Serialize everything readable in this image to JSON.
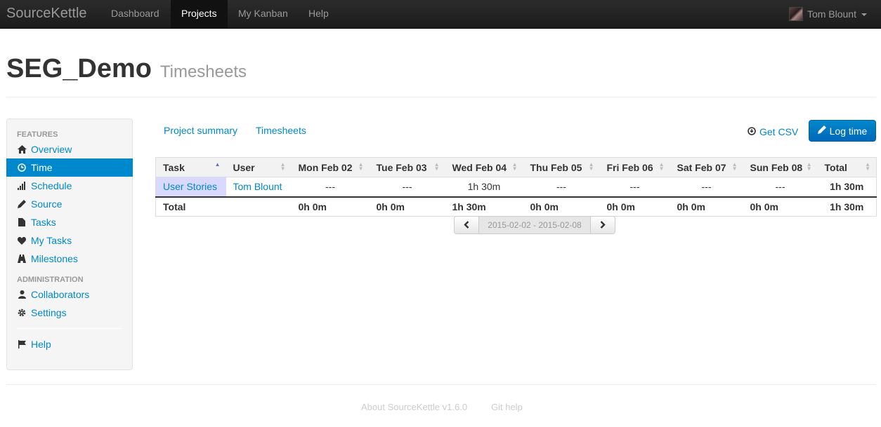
{
  "navbar": {
    "brand": "SourceKettle",
    "items": [
      {
        "label": "Dashboard"
      },
      {
        "label": "Projects"
      },
      {
        "label": "My Kanban"
      },
      {
        "label": "Help"
      }
    ],
    "active_item": "Projects",
    "user_name": "Tom Blount"
  },
  "page": {
    "title": "SEG_Demo",
    "subtitle": "Timesheets"
  },
  "sidebar": {
    "features_header": "FEATURES",
    "features": [
      {
        "label": "Overview",
        "icon": "home-icon"
      },
      {
        "label": "Time",
        "icon": "clock-icon",
        "active": true
      },
      {
        "label": "Schedule",
        "icon": "signal-icon"
      },
      {
        "label": "Source",
        "icon": "pencil-icon"
      },
      {
        "label": "Tasks",
        "icon": "file-icon"
      },
      {
        "label": "My Tasks",
        "icon": "heart-icon"
      },
      {
        "label": "Milestones",
        "icon": "road-icon"
      }
    ],
    "admin_header": "ADMINISTRATION",
    "admin": [
      {
        "label": "Collaborators",
        "icon": "user-icon"
      },
      {
        "label": "Settings",
        "icon": "cog-icon"
      }
    ],
    "help": {
      "label": "Help",
      "icon": "flag-icon"
    }
  },
  "tabs": [
    {
      "label": "Project summary"
    },
    {
      "label": "Timesheets"
    }
  ],
  "actions": {
    "csv_label": "Get CSV",
    "log_time_label": "Log time"
  },
  "timesheet": {
    "headers": [
      "Task",
      "User",
      "Mon Feb 02",
      "Tue Feb 03",
      "Wed Feb 04",
      "Thu Feb 05",
      "Fri Feb 06",
      "Sat Feb 07",
      "Sun Feb 08",
      "Total"
    ],
    "row": {
      "task": "User Stories",
      "user": "Tom Blount",
      "days": [
        "---",
        "---",
        "1h 30m",
        "---",
        "---",
        "---",
        "---"
      ],
      "total": "1h 30m"
    },
    "total_row": {
      "label": "Total",
      "days": [
        "0h 0m",
        "0h 0m",
        "1h 30m",
        "0h 0m",
        "0h 0m",
        "0h 0m",
        "0h 0m"
      ],
      "total": "1h 30m"
    }
  },
  "pager": {
    "range": "2015-02-02 - 2015-02-08"
  },
  "footer": {
    "about": "About SourceKettle v1.6.0",
    "git_help": "Git help"
  }
}
